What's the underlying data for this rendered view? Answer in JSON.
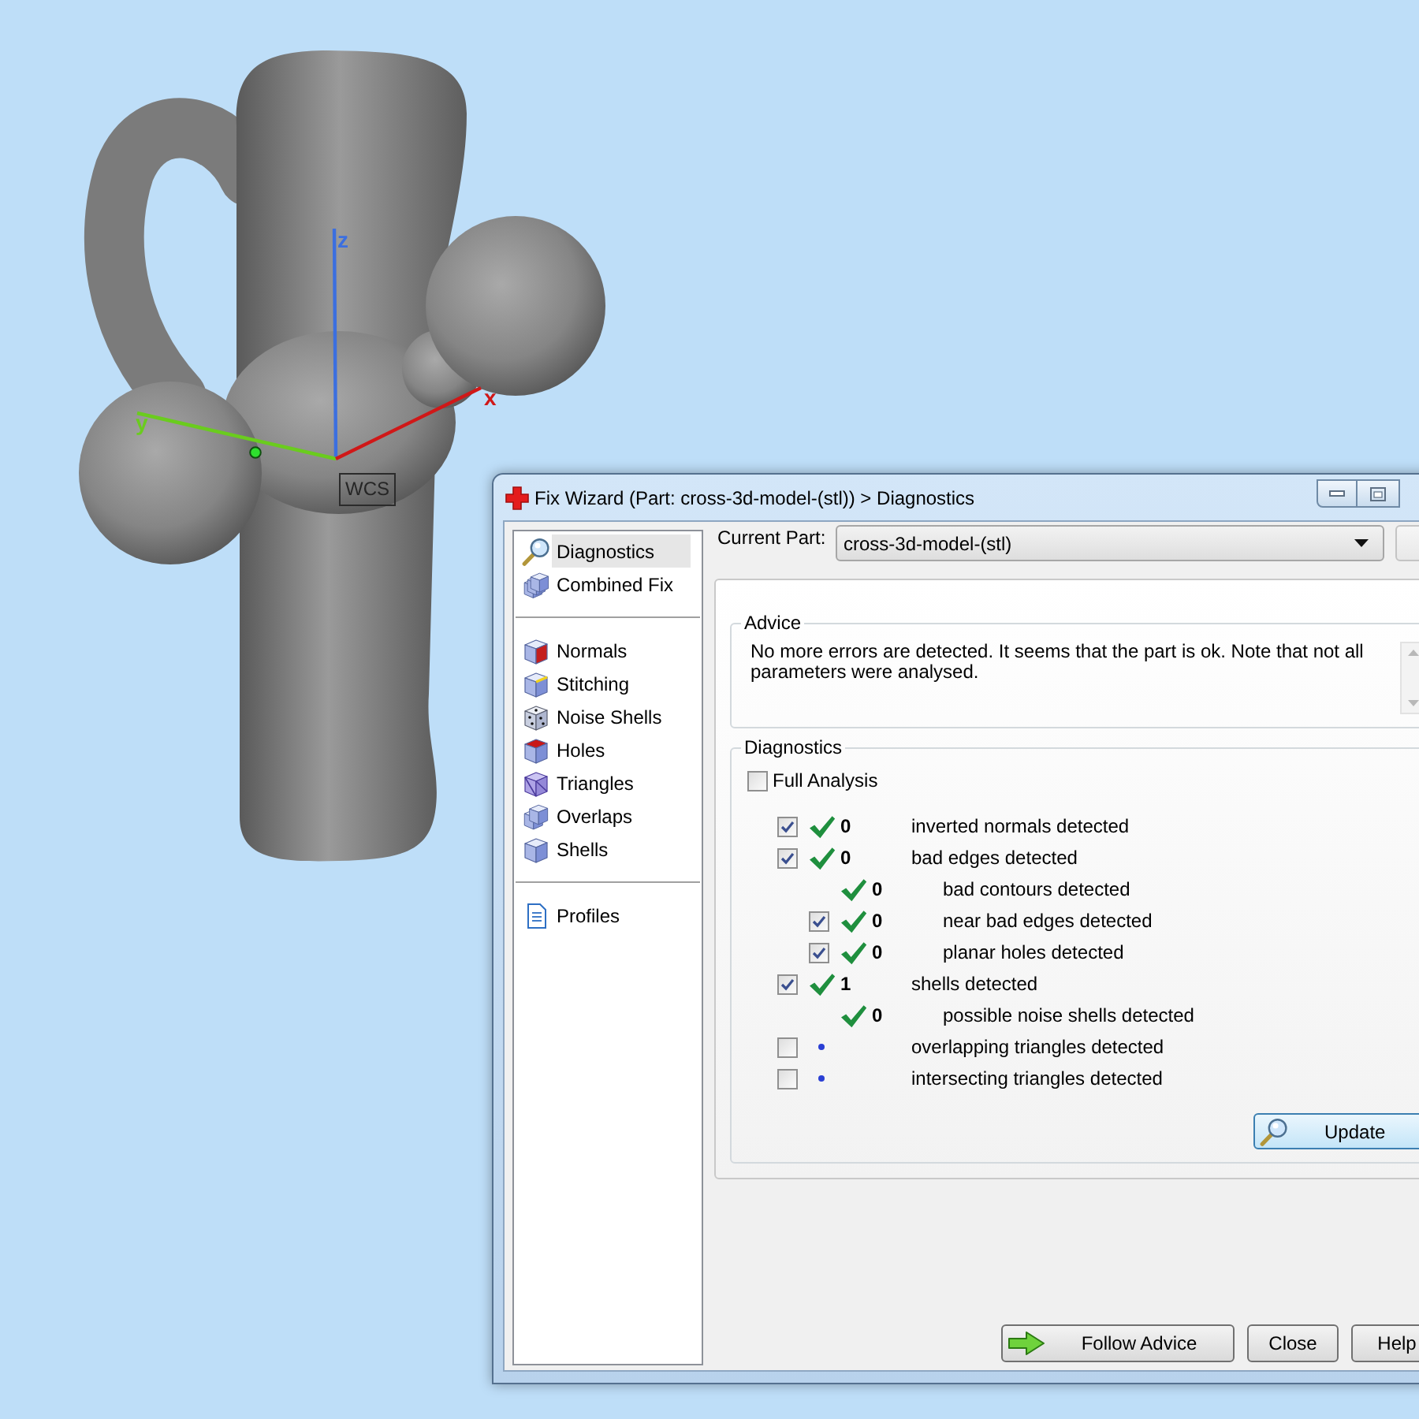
{
  "viewport": {
    "axes": [
      {
        "label": "z",
        "color": "#3b6fe0"
      },
      {
        "label": "y",
        "color": "#6acc1e"
      },
      {
        "label": "x",
        "color": "#d01818"
      }
    ],
    "origin_label": "WCS"
  },
  "window": {
    "title": "Fix Wizard (Part: cross-3d-model-(stl)) > Diagnostics"
  },
  "sidebar": {
    "groups": [
      [
        {
          "label": "Diagnostics",
          "selected": true
        },
        {
          "label": "Combined Fix",
          "selected": false
        }
      ],
      [
        {
          "label": "Normals",
          "selected": false
        },
        {
          "label": "Stitching",
          "selected": false
        },
        {
          "label": "Noise Shells",
          "selected": false
        },
        {
          "label": "Holes",
          "selected": false
        },
        {
          "label": "Triangles",
          "selected": false
        },
        {
          "label": "Overlaps",
          "selected": false
        },
        {
          "label": "Shells",
          "selected": false
        }
      ],
      [
        {
          "label": "Profiles",
          "selected": false
        }
      ]
    ]
  },
  "current_part": {
    "label": "Current Part:",
    "value": "cross-3d-model-(stl)"
  },
  "advice": {
    "title": "Advice",
    "text": "No more errors are detected. It seems that the part is ok. Note that not all parameters were analysed."
  },
  "diagnostics": {
    "title": "Diagnostics",
    "full_analysis": {
      "label": "Full Analysis",
      "checked": false
    },
    "items": [
      {
        "kind": "toggle",
        "checked": true,
        "analysed": true,
        "count": "0",
        "label": "inverted normals detected"
      },
      {
        "kind": "toggle",
        "checked": true,
        "analysed": true,
        "count": "0",
        "label": "bad edges detected",
        "children": [
          {
            "kind": "info",
            "analysed": true,
            "count": "0",
            "label": "bad contours detected"
          },
          {
            "kind": "toggle",
            "checked": true,
            "analysed": true,
            "count": "0",
            "label": "near bad edges detected"
          },
          {
            "kind": "toggle",
            "checked": true,
            "analysed": true,
            "count": "0",
            "label": "planar holes detected"
          }
        ]
      },
      {
        "kind": "toggle",
        "checked": true,
        "analysed": true,
        "count": "1",
        "label": "shells detected",
        "children": [
          {
            "kind": "info",
            "analysed": true,
            "count": "0",
            "label": "possible noise shells detected"
          }
        ]
      },
      {
        "kind": "toggle",
        "checked": false,
        "analysed": false,
        "label": "overlapping triangles detected"
      },
      {
        "kind": "toggle",
        "checked": false,
        "analysed": false,
        "label": "intersecting triangles detected"
      }
    ],
    "update_button": {
      "label": "Update"
    }
  },
  "buttons": [
    {
      "label": "Follow Advice",
      "kind": "arrow"
    },
    {
      "label": "Close",
      "kind": "plain"
    },
    {
      "label": "Help",
      "kind": "plain"
    }
  ]
}
